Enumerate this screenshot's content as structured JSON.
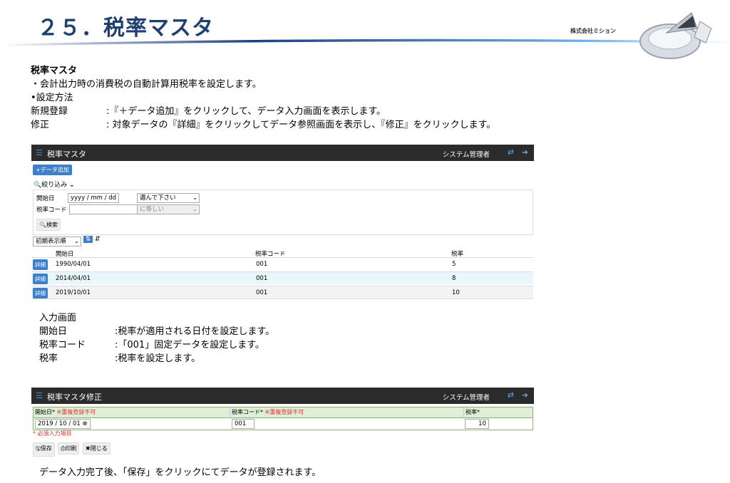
{
  "header": {
    "title": "２５．税率マスタ",
    "company": "株式会社ミション"
  },
  "doc": {
    "heading": "税率マスタ",
    "line1": "・会計出力時の消費税の自動計算用税率を設定します。",
    "line2": "•設定方法",
    "new_label": "新規登録",
    "new_text": ":『＋データ追加』をクリックして、データ入力画面を表示します。",
    "edit_label": "修正",
    "edit_text": ": 対象データの『詳細』をクリックしてデータ参照画面を表示し、『修正』をクリックします。"
  },
  "list_panel": {
    "title": "税率マスタ",
    "user": "システム管理者",
    "add_button": "+データ追加",
    "filter_label": "絞り込み",
    "start_date_label": "開始日",
    "start_date_placeholder": "yyyy / mm / dd",
    "select_placeholder": "選んで下さい",
    "tax_code_label": "税率コード",
    "equal_option": "に等しい",
    "search_button": "検索",
    "sort_select": "初期表示順",
    "columns": [
      "開始日",
      "税率コード",
      "税率"
    ],
    "detail_label": "詳細",
    "rows": [
      {
        "start": "1990/04/01",
        "code": "001",
        "rate": "5"
      },
      {
        "start": "2014/04/01",
        "code": "001",
        "rate": "8"
      },
      {
        "start": "2019/10/01",
        "code": "001",
        "rate": "10"
      }
    ]
  },
  "input_doc": {
    "heading": "入力画面",
    "items": [
      {
        "label": "開始日",
        "text": ":税率が適用される日付を設定します。"
      },
      {
        "label": "税率コード",
        "text": ":「001」固定データを設定します。"
      },
      {
        "label": "税率",
        "text": ":税率を設定します。"
      }
    ]
  },
  "edit_panel": {
    "title": "税率マスタ修正",
    "user": "システム管理者",
    "col_start": "開始日*",
    "col_start_note": "※重複登録不可",
    "col_code": "税率コード*",
    "col_code_note": "※重複登録不可",
    "col_rate": "税率*",
    "start_value": "2019 / 10 / 01",
    "code_value": "001",
    "rate_value": "10",
    "required_note": "* 必須入力項目",
    "save_button": "保存",
    "print_button": "印刷",
    "close_button": "閉じる"
  },
  "footer": {
    "text": "データ入力完了後、「保存」をクリックにてデータが登録されます。"
  }
}
